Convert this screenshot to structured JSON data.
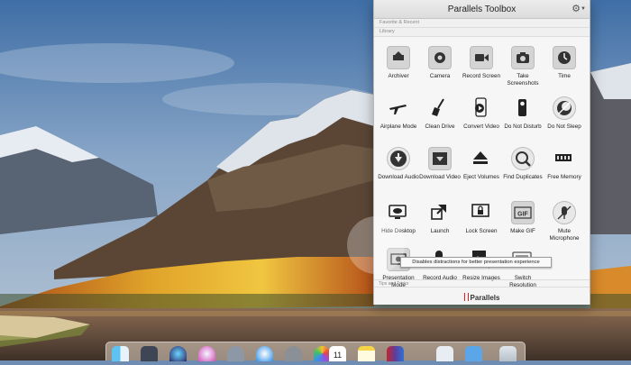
{
  "toolbox": {
    "title": "Parallels Toolbox",
    "sections": {
      "favorites": "Favorite & Recent",
      "library": "Library",
      "tips": "Tips and Tricks"
    },
    "brand": "Parallels",
    "tools": [
      {
        "label": "Archiver",
        "icon": "archiver-icon"
      },
      {
        "label": "Camera",
        "icon": "camera-icon"
      },
      {
        "label": "Record Screen",
        "icon": "record-screen-icon"
      },
      {
        "label": "Take Screenshots",
        "icon": "screenshot-icon"
      },
      {
        "label": "Time",
        "icon": "clock-icon"
      },
      {
        "label": "Airplane Mode",
        "icon": "airplane-icon"
      },
      {
        "label": "Clean Drive",
        "icon": "broom-icon"
      },
      {
        "label": "Convert Video",
        "icon": "convert-video-icon"
      },
      {
        "label": "Do Not Disturb",
        "icon": "door-hanger-icon"
      },
      {
        "label": "Do Not Sleep",
        "icon": "moon-icon"
      },
      {
        "label": "Download Audio",
        "icon": "download-audio-icon"
      },
      {
        "label": "Download Video",
        "icon": "download-video-icon"
      },
      {
        "label": "Eject Volumes",
        "icon": "eject-icon"
      },
      {
        "label": "Find Duplicates",
        "icon": "find-duplicates-icon"
      },
      {
        "label": "Free Memory",
        "icon": "memory-icon"
      },
      {
        "label": "Hide Desktop",
        "icon": "hide-desktop-icon"
      },
      {
        "label": "Launch",
        "icon": "launch-icon"
      },
      {
        "label": "Lock Screen",
        "icon": "lock-screen-icon"
      },
      {
        "label": "Make GIF",
        "icon": "gif-icon"
      },
      {
        "label": "Mute Microphone",
        "icon": "microphone-icon"
      },
      {
        "label": "Presentation Mode",
        "icon": "presentation-icon"
      },
      {
        "label": "Record Audio",
        "icon": "record-audio-icon"
      },
      {
        "label": "Resize Images",
        "icon": "resize-images-icon"
      },
      {
        "label": "Switch Resolution",
        "icon": "resolution-icon"
      }
    ],
    "tooltip": "Disables distractions for better presentation experience"
  },
  "dock": {
    "apps": [
      "finder-icon",
      "launchpad-icon",
      "siri-icon",
      "itunes-icon",
      "rocket-icon",
      "safari-icon",
      "settings-icon",
      "photos-icon",
      "calendar-icon",
      "notes-icon",
      "parallels-icon",
      "preview-icon",
      "folder-icon",
      "trash-icon"
    ],
    "calendar_day": "11"
  }
}
